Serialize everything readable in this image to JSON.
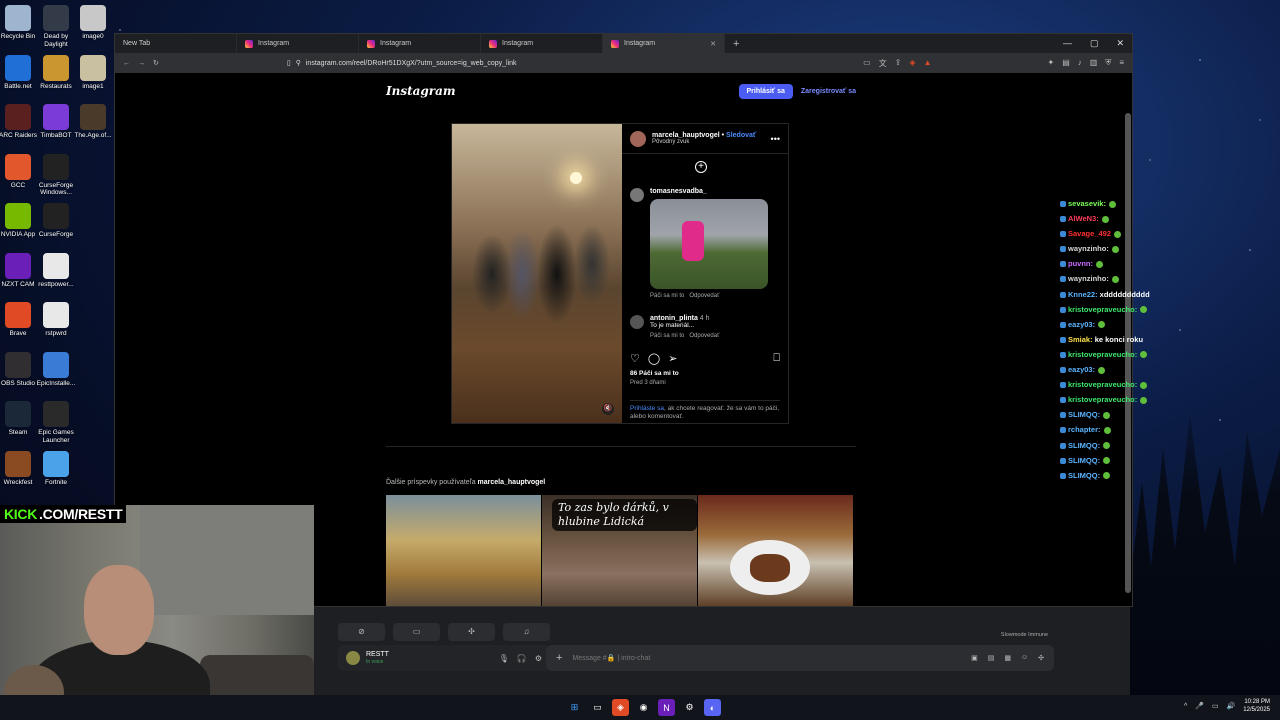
{
  "desktop": {
    "icons": [
      {
        "label": "Recycle Bin",
        "icon": "recycle-bin-icon",
        "color": "#9fb4cf"
      },
      {
        "label": "Dead by Daylight",
        "icon": "dead-by-daylight-icon",
        "color": "#333a48"
      },
      {
        "label": "image0",
        "icon": "image-file-icon",
        "color": "#c8c8c8"
      },
      {
        "label": "Battle.net",
        "icon": "battlenet-icon",
        "color": "#1f6fd6"
      },
      {
        "label": "Restaurats",
        "icon": "restaurats-icon",
        "color": "#c99630"
      },
      {
        "label": "image1",
        "icon": "image-file-icon",
        "color": "#c8c0a0"
      },
      {
        "label": "ARC Raiders",
        "icon": "arc-raiders-icon",
        "color": "#5a1f1f"
      },
      {
        "label": "TimbaBOT",
        "icon": "timbabot-icon",
        "color": "#7b3bd6"
      },
      {
        "label": "The.Age.of...",
        "icon": "age-of-icon",
        "color": "#4a3a2a"
      },
      {
        "label": "GCC",
        "icon": "gcc-icon",
        "color": "#e2572b"
      },
      {
        "label": "CurseForge Windows...",
        "icon": "curseforge-icon",
        "color": "#222"
      },
      {
        "label": "NVIDIA App",
        "icon": "nvidia-icon",
        "color": "#76b900"
      },
      {
        "label": "CurseForge",
        "icon": "curseforge-icon",
        "color": "#222"
      },
      {
        "label": "NZXT CAM",
        "icon": "nzxt-icon",
        "color": "#6a1fb8"
      },
      {
        "label": "resttpower...",
        "icon": "file-icon",
        "color": "#e8e8e8"
      },
      {
        "label": "Brave",
        "icon": "brave-icon",
        "color": "#e04a25"
      },
      {
        "label": "rstpwrd",
        "icon": "file-icon",
        "color": "#e8e8e8"
      },
      {
        "label": "OBS Studio",
        "icon": "obs-icon",
        "color": "#302e31"
      },
      {
        "label": "EpicInstalle...",
        "icon": "epic-installer-icon",
        "color": "#3a7bd5"
      },
      {
        "label": "Steam",
        "icon": "steam-icon",
        "color": "#1b2838"
      },
      {
        "label": "Epic Games Launcher",
        "icon": "epic-games-icon",
        "color": "#2a2a2a"
      },
      {
        "label": "Wreckfest",
        "icon": "wreckfest-icon",
        "color": "#8a4a22"
      },
      {
        "label": "Fortnite",
        "icon": "fortnite-icon",
        "color": "#4aa3e8"
      }
    ]
  },
  "browser": {
    "tabs": [
      {
        "label": "New Tab",
        "icon": ""
      },
      {
        "label": "Instagram",
        "icon": "instagram-icon"
      },
      {
        "label": "Instagram",
        "icon": "instagram-icon"
      },
      {
        "label": "Instagram",
        "icon": "instagram-icon"
      },
      {
        "label": "Instagram",
        "icon": "instagram-icon",
        "active": true
      }
    ],
    "url": "instagram.com/reel/DRoHr51DXgX/?utm_source=ig_web_copy_link"
  },
  "instagram": {
    "logo": "Instagram",
    "login_label": "Prihlásiť sa",
    "signup_label": "Zaregistrovať sa",
    "post": {
      "author": "marcela_hauptvogel",
      "follow_label": "Sledovať",
      "audio": "Pôvodný zvuk",
      "comments": [
        {
          "user": "tomasnesvadba_",
          "text": "",
          "has_gif": true,
          "like_label": "Páči sa mi to",
          "reply_label": "Odpovedať"
        },
        {
          "user": "antonin_plinta",
          "time": "4 h",
          "text": "To je materiál...",
          "like_label": "Páči sa mi to",
          "reply_label": "Odpovedať"
        }
      ],
      "likes": "86 Páči sa mi to",
      "ago": "Pred 3 dňami",
      "login_link": "Prihláste sa",
      "login_note": ", ak chcete reagovať. že sa vám to páči, alebo komentovať."
    },
    "more_posts_prefix": "Ďalšie príspevky používateľa",
    "more_posts_user": "marcela_hauptvogel",
    "thumb2_caption": "To zas bylo dárků, v hlubine Lidická"
  },
  "chat": {
    "messages": [
      {
        "user": "sevasevik:",
        "color": "#7cff5a",
        "text": "",
        "emote": true
      },
      {
        "user": "AlWeN3:",
        "color": "#ff3b5a",
        "text": "",
        "emote": true
      },
      {
        "user": "Savage_492",
        "color": "#ff3030",
        "text": "",
        "emote": true
      },
      {
        "user": "waynzinho:",
        "color": "#d8d8d8",
        "text": "",
        "emote": true
      },
      {
        "user": "puvnn:",
        "color": "#c86bff",
        "text": "",
        "emote": true
      },
      {
        "user": "waynzinho:",
        "color": "#d8d8d8",
        "text": "",
        "emote": true
      },
      {
        "user": "Knne22:",
        "color": "#5ab4ff",
        "text": "xdddddddddd",
        "emote": false
      },
      {
        "user": "kristovepraveucho:",
        "color": "#3ee86b",
        "text": "",
        "emote": true
      },
      {
        "user": "eazy03:",
        "color": "#5ab4ff",
        "text": "",
        "emote": true
      },
      {
        "user": "Smiak:",
        "color": "#ffe04a",
        "text": "ke konci roku",
        "emote": false
      },
      {
        "user": "kristovepraveucho:",
        "color": "#3ee86b",
        "text": "",
        "emote": true
      },
      {
        "user": "eazy03:",
        "color": "#5ab4ff",
        "text": "",
        "emote": true
      },
      {
        "user": "kristovepraveucho:",
        "color": "#3ee86b",
        "text": "",
        "emote": true
      },
      {
        "user": "kristovepraveucho:",
        "color": "#3ee86b",
        "text": "",
        "emote": true
      },
      {
        "user": "SLIMQQ:",
        "color": "#5ab4ff",
        "text": "",
        "emote": true
      },
      {
        "user": "rchapter:",
        "color": "#5ab4ff",
        "text": "",
        "emote": true
      },
      {
        "user": "SLIMQQ:",
        "color": "#5ab4ff",
        "text": "",
        "emote": true
      },
      {
        "user": "SLIMQQ:",
        "color": "#5ab4ff",
        "text": "",
        "emote": true
      },
      {
        "user": "SLIMQQ:",
        "color": "#5ab4ff",
        "text": "",
        "emote": true
      }
    ]
  },
  "stream": {
    "kick_prefix": "KICK",
    "kick_text": ".COM/RESTT"
  },
  "discord": {
    "user": "RESTT",
    "status": "In voice",
    "message_placeholder": "Message #🔒 | intro-chat",
    "slowmode": "Slowmode Immune"
  },
  "taskbar": {
    "time": "10:28 PM",
    "date": "12/5/2025"
  }
}
